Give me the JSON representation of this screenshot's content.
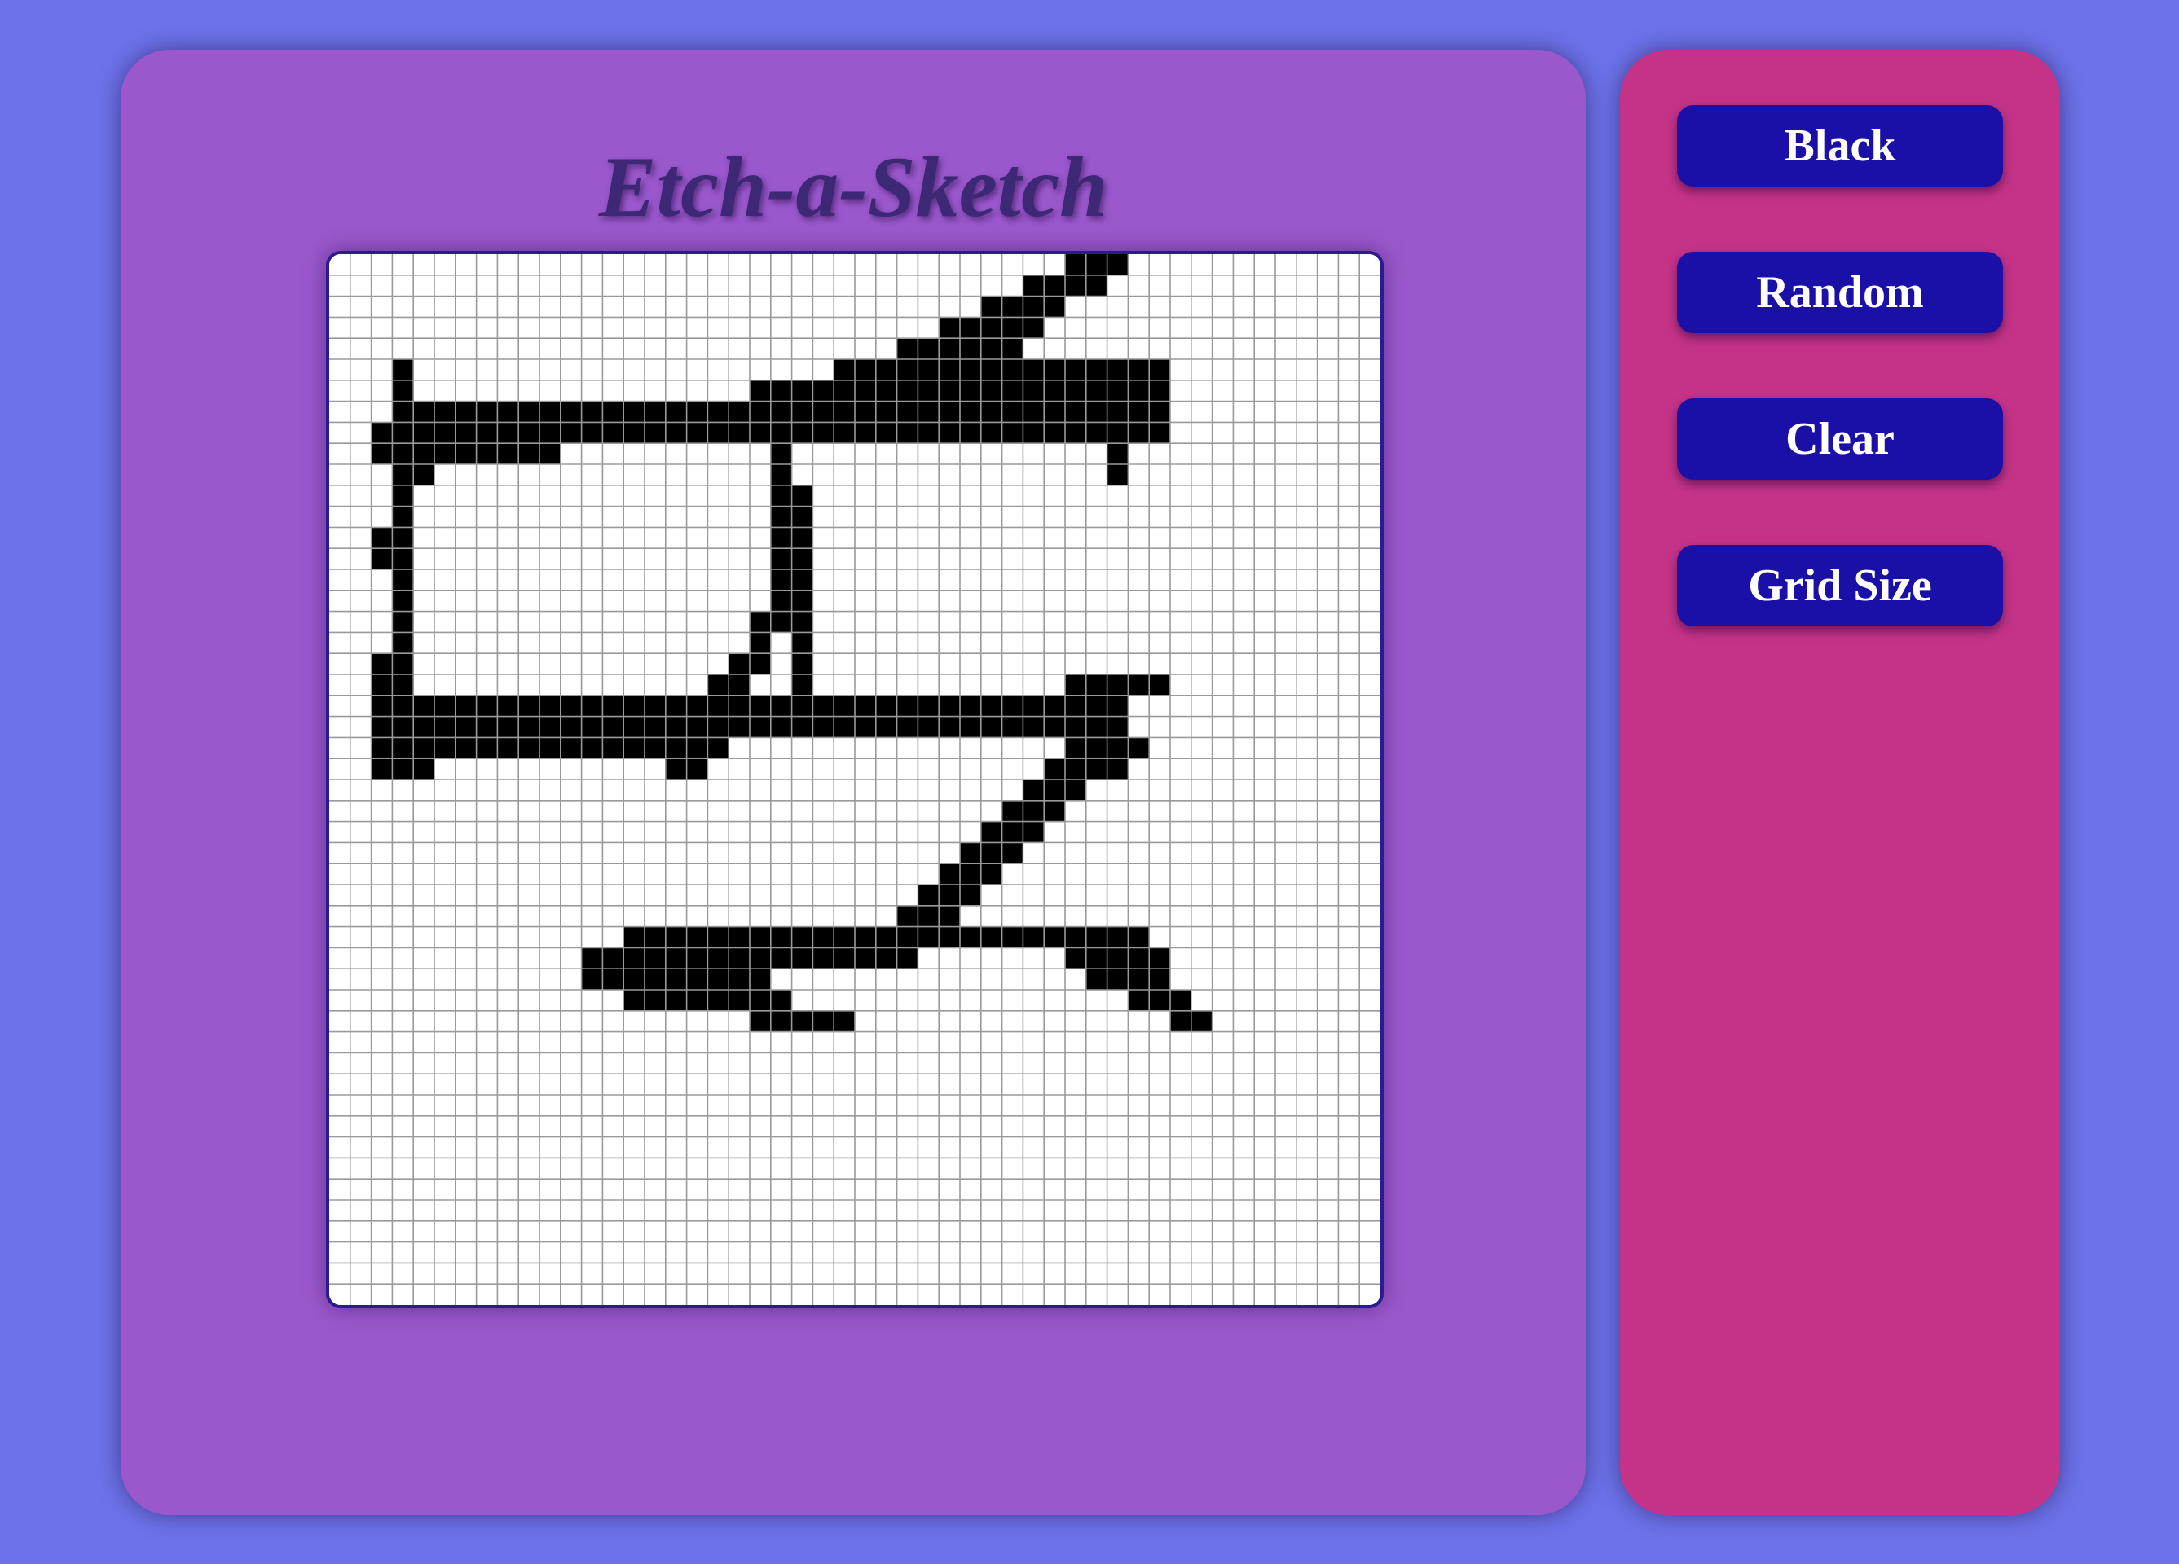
{
  "app": {
    "title": "Etch-a-Sketch"
  },
  "controls": {
    "black_label": "Black",
    "random_label": "Random",
    "clear_label": "Clear",
    "grid_size_label": "Grid Size"
  },
  "sketch": {
    "grid_size": 50,
    "ink_color": "#000000",
    "blank_color": "#ffffff",
    "grid_line_color": "#9a9a9a",
    "filled_cells": [
      [
        3,
        5
      ],
      [
        3,
        6
      ],
      [
        3,
        7
      ],
      [
        3,
        8
      ],
      [
        3,
        9
      ],
      [
        3,
        10
      ],
      [
        3,
        11
      ],
      [
        3,
        12
      ],
      [
        3,
        13
      ],
      [
        3,
        14
      ],
      [
        3,
        15
      ],
      [
        3,
        16
      ],
      [
        3,
        17
      ],
      [
        3,
        18
      ],
      [
        3,
        19
      ],
      [
        3,
        20
      ],
      [
        2,
        8
      ],
      [
        2,
        9
      ],
      [
        2,
        13
      ],
      [
        2,
        14
      ],
      [
        4,
        7
      ],
      [
        4,
        8
      ],
      [
        4,
        9
      ],
      [
        4,
        10
      ],
      [
        5,
        7
      ],
      [
        5,
        8
      ],
      [
        5,
        9
      ],
      [
        6,
        7
      ],
      [
        6,
        8
      ],
      [
        6,
        9
      ],
      [
        7,
        7
      ],
      [
        7,
        8
      ],
      [
        7,
        9
      ],
      [
        8,
        7
      ],
      [
        8,
        8
      ],
      [
        8,
        9
      ],
      [
        9,
        7
      ],
      [
        9,
        8
      ],
      [
        9,
        9
      ],
      [
        10,
        7
      ],
      [
        10,
        8
      ],
      [
        10,
        9
      ],
      [
        11,
        7
      ],
      [
        11,
        8
      ],
      [
        12,
        7
      ],
      [
        12,
        8
      ],
      [
        13,
        7
      ],
      [
        13,
        8
      ],
      [
        14,
        7
      ],
      [
        14,
        8
      ],
      [
        15,
        7
      ],
      [
        15,
        8
      ],
      [
        16,
        7
      ],
      [
        16,
        8
      ],
      [
        17,
        7
      ],
      [
        17,
        8
      ],
      [
        18,
        7
      ],
      [
        18,
        8
      ],
      [
        19,
        7
      ],
      [
        19,
        8
      ],
      [
        20,
        7
      ],
      [
        20,
        8
      ],
      [
        21,
        7
      ],
      [
        21,
        8
      ],
      [
        22,
        7
      ],
      [
        22,
        8
      ],
      [
        23,
        7
      ],
      [
        23,
        8
      ],
      [
        24,
        7
      ],
      [
        24,
        8
      ],
      [
        25,
        7
      ],
      [
        25,
        8
      ],
      [
        26,
        7
      ],
      [
        26,
        8
      ],
      [
        27,
        7
      ],
      [
        27,
        8
      ],
      [
        28,
        7
      ],
      [
        28,
        8
      ],
      [
        29,
        7
      ],
      [
        29,
        8
      ],
      [
        30,
        7
      ],
      [
        30,
        8
      ],
      [
        31,
        7
      ],
      [
        31,
        8
      ],
      [
        32,
        7
      ],
      [
        32,
        8
      ],
      [
        33,
        7
      ],
      [
        33,
        8
      ],
      [
        34,
        7
      ],
      [
        34,
        8
      ],
      [
        35,
        7
      ],
      [
        35,
        8
      ],
      [
        36,
        7
      ],
      [
        36,
        8
      ],
      [
        37,
        7
      ],
      [
        37,
        8
      ],
      [
        38,
        7
      ],
      [
        38,
        8
      ],
      [
        39,
        7
      ],
      [
        39,
        8
      ],
      [
        20,
        6
      ],
      [
        21,
        6
      ],
      [
        22,
        6
      ],
      [
        23,
        6
      ],
      [
        24,
        6
      ],
      [
        25,
        6
      ],
      [
        26,
        6
      ],
      [
        27,
        6
      ],
      [
        28,
        6
      ],
      [
        29,
        6
      ],
      [
        30,
        6
      ],
      [
        31,
        6
      ],
      [
        32,
        6
      ],
      [
        33,
        6
      ],
      [
        34,
        6
      ],
      [
        35,
        6
      ],
      [
        36,
        6
      ],
      [
        37,
        6
      ],
      [
        38,
        6
      ],
      [
        39,
        6
      ],
      [
        24,
        5
      ],
      [
        25,
        5
      ],
      [
        26,
        5
      ],
      [
        27,
        5
      ],
      [
        28,
        5
      ],
      [
        29,
        5
      ],
      [
        30,
        5
      ],
      [
        31,
        5
      ],
      [
        32,
        5
      ],
      [
        33,
        5
      ],
      [
        34,
        5
      ],
      [
        35,
        5
      ],
      [
        36,
        5
      ],
      [
        37,
        5
      ],
      [
        38,
        5
      ],
      [
        39,
        5
      ],
      [
        27,
        4
      ],
      [
        28,
        4
      ],
      [
        29,
        4
      ],
      [
        30,
        4
      ],
      [
        31,
        4
      ],
      [
        32,
        4
      ],
      [
        29,
        3
      ],
      [
        30,
        3
      ],
      [
        31,
        3
      ],
      [
        32,
        3
      ],
      [
        33,
        3
      ],
      [
        31,
        2
      ],
      [
        32,
        2
      ],
      [
        33,
        2
      ],
      [
        34,
        2
      ],
      [
        33,
        1
      ],
      [
        34,
        1
      ],
      [
        35,
        1
      ],
      [
        36,
        1
      ],
      [
        35,
        0
      ],
      [
        36,
        0
      ],
      [
        37,
        0
      ],
      [
        37,
        9
      ],
      [
        37,
        10
      ],
      [
        21,
        9
      ],
      [
        21,
        10
      ],
      [
        21,
        11
      ],
      [
        21,
        12
      ],
      [
        21,
        13
      ],
      [
        21,
        14
      ],
      [
        21,
        15
      ],
      [
        21,
        16
      ],
      [
        21,
        17
      ],
      [
        22,
        11
      ],
      [
        22,
        12
      ],
      [
        22,
        13
      ],
      [
        22,
        14
      ],
      [
        22,
        15
      ],
      [
        22,
        16
      ],
      [
        22,
        17
      ],
      [
        22,
        18
      ],
      [
        22,
        19
      ],
      [
        22,
        20
      ],
      [
        22,
        21
      ],
      [
        20,
        17
      ],
      [
        20,
        18
      ],
      [
        20,
        19
      ],
      [
        19,
        19
      ],
      [
        19,
        20
      ],
      [
        19,
        21
      ],
      [
        18,
        20
      ],
      [
        18,
        21
      ],
      [
        18,
        22
      ],
      [
        18,
        23
      ],
      [
        17,
        22
      ],
      [
        17,
        23
      ],
      [
        17,
        24
      ],
      [
        16,
        23
      ],
      [
        16,
        24
      ],
      [
        2,
        19
      ],
      [
        2,
        20
      ],
      [
        2,
        21
      ],
      [
        2,
        22
      ],
      [
        2,
        23
      ],
      [
        2,
        24
      ],
      [
        3,
        21
      ],
      [
        3,
        22
      ],
      [
        3,
        23
      ],
      [
        3,
        24
      ],
      [
        4,
        21
      ],
      [
        4,
        22
      ],
      [
        4,
        23
      ],
      [
        4,
        24
      ],
      [
        5,
        21
      ],
      [
        5,
        22
      ],
      [
        5,
        23
      ],
      [
        6,
        21
      ],
      [
        6,
        22
      ],
      [
        6,
        23
      ],
      [
        7,
        21
      ],
      [
        7,
        22
      ],
      [
        7,
        23
      ],
      [
        8,
        21
      ],
      [
        8,
        22
      ],
      [
        8,
        23
      ],
      [
        9,
        21
      ],
      [
        9,
        22
      ],
      [
        9,
        23
      ],
      [
        10,
        21
      ],
      [
        10,
        22
      ],
      [
        10,
        23
      ],
      [
        11,
        21
      ],
      [
        11,
        22
      ],
      [
        11,
        23
      ],
      [
        12,
        21
      ],
      [
        12,
        22
      ],
      [
        12,
        23
      ],
      [
        13,
        21
      ],
      [
        13,
        22
      ],
      [
        13,
        23
      ],
      [
        14,
        21
      ],
      [
        14,
        22
      ],
      [
        14,
        23
      ],
      [
        15,
        21
      ],
      [
        15,
        22
      ],
      [
        15,
        23
      ],
      [
        16,
        21
      ],
      [
        16,
        22
      ],
      [
        17,
        21
      ],
      [
        17,
        22
      ],
      [
        18,
        21
      ],
      [
        18,
        22
      ],
      [
        19,
        21
      ],
      [
        19,
        22
      ],
      [
        20,
        21
      ],
      [
        20,
        22
      ],
      [
        21,
        21
      ],
      [
        21,
        22
      ],
      [
        22,
        21
      ],
      [
        22,
        22
      ],
      [
        23,
        21
      ],
      [
        23,
        22
      ],
      [
        24,
        21
      ],
      [
        24,
        22
      ],
      [
        25,
        21
      ],
      [
        25,
        22
      ],
      [
        26,
        21
      ],
      [
        26,
        22
      ],
      [
        27,
        21
      ],
      [
        27,
        22
      ],
      [
        28,
        21
      ],
      [
        28,
        22
      ],
      [
        29,
        21
      ],
      [
        29,
        22
      ],
      [
        30,
        21
      ],
      [
        30,
        22
      ],
      [
        31,
        21
      ],
      [
        31,
        22
      ],
      [
        32,
        21
      ],
      [
        32,
        22
      ],
      [
        33,
        21
      ],
      [
        33,
        22
      ],
      [
        34,
        21
      ],
      [
        34,
        22
      ],
      [
        35,
        21
      ],
      [
        35,
        22
      ],
      [
        36,
        21
      ],
      [
        36,
        22
      ],
      [
        37,
        21
      ],
      [
        37,
        22
      ],
      [
        35,
        20
      ],
      [
        36,
        20
      ],
      [
        37,
        20
      ],
      [
        38,
        20
      ],
      [
        39,
        20
      ],
      [
        35,
        23
      ],
      [
        36,
        23
      ],
      [
        37,
        23
      ],
      [
        38,
        23
      ],
      [
        34,
        24
      ],
      [
        35,
        24
      ],
      [
        36,
        24
      ],
      [
        37,
        24
      ],
      [
        33,
        25
      ],
      [
        34,
        25
      ],
      [
        35,
        25
      ],
      [
        32,
        26
      ],
      [
        33,
        26
      ],
      [
        34,
        26
      ],
      [
        31,
        27
      ],
      [
        32,
        27
      ],
      [
        33,
        27
      ],
      [
        30,
        28
      ],
      [
        31,
        28
      ],
      [
        32,
        28
      ],
      [
        29,
        29
      ],
      [
        30,
        29
      ],
      [
        31,
        29
      ],
      [
        28,
        30
      ],
      [
        29,
        30
      ],
      [
        30,
        30
      ],
      [
        27,
        31
      ],
      [
        28,
        31
      ],
      [
        29,
        31
      ],
      [
        26,
        32
      ],
      [
        27,
        32
      ],
      [
        28,
        32
      ],
      [
        25,
        33
      ],
      [
        26,
        33
      ],
      [
        27,
        33
      ],
      [
        24,
        33
      ],
      [
        23,
        33
      ],
      [
        22,
        33
      ],
      [
        21,
        33
      ],
      [
        20,
        33
      ],
      [
        19,
        33
      ],
      [
        18,
        33
      ],
      [
        17,
        33
      ],
      [
        16,
        33
      ],
      [
        15,
        33
      ],
      [
        14,
        33
      ],
      [
        13,
        33
      ],
      [
        21,
        32
      ],
      [
        22,
        32
      ],
      [
        23,
        32
      ],
      [
        24,
        32
      ],
      [
        25,
        32
      ],
      [
        26,
        32
      ],
      [
        27,
        32
      ],
      [
        28,
        32
      ],
      [
        29,
        32
      ],
      [
        30,
        32
      ],
      [
        31,
        32
      ],
      [
        32,
        32
      ],
      [
        33,
        32
      ],
      [
        34,
        32
      ],
      [
        35,
        32
      ],
      [
        36,
        32
      ],
      [
        37,
        32
      ],
      [
        38,
        32
      ],
      [
        14,
        32
      ],
      [
        15,
        32
      ],
      [
        16,
        32
      ],
      [
        17,
        32
      ],
      [
        18,
        32
      ],
      [
        19,
        32
      ],
      [
        20,
        32
      ],
      [
        14,
        34
      ],
      [
        15,
        34
      ],
      [
        16,
        34
      ],
      [
        17,
        34
      ],
      [
        18,
        34
      ],
      [
        19,
        34
      ],
      [
        20,
        34
      ],
      [
        12,
        33
      ],
      [
        13,
        34
      ],
      [
        12,
        34
      ],
      [
        35,
        33
      ],
      [
        36,
        33
      ],
      [
        37,
        33
      ],
      [
        38,
        33
      ],
      [
        37,
        34
      ],
      [
        38,
        34
      ],
      [
        39,
        34
      ],
      [
        36,
        34
      ],
      [
        39,
        33
      ],
      [
        14,
        35
      ],
      [
        15,
        35
      ],
      [
        16,
        35
      ],
      [
        17,
        35
      ],
      [
        18,
        35
      ],
      [
        19,
        35
      ],
      [
        20,
        35
      ],
      [
        21,
        35
      ],
      [
        20,
        36
      ],
      [
        21,
        36
      ],
      [
        22,
        36
      ],
      [
        23,
        36
      ],
      [
        24,
        36
      ],
      [
        38,
        35
      ],
      [
        39,
        35
      ],
      [
        40,
        35
      ],
      [
        40,
        36
      ],
      [
        41,
        36
      ]
    ]
  }
}
